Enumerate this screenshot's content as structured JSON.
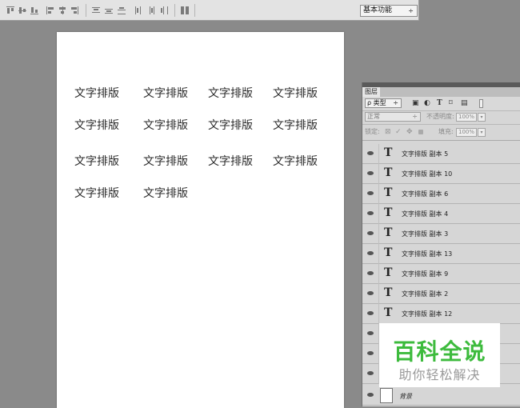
{
  "workspace": {
    "label": "基本功能",
    "arrow": "÷"
  },
  "canvas": {
    "texts": [
      "文字排版",
      "文字排版",
      "文字排版",
      "文字排版",
      "文字排版",
      "文字排版",
      "文字排版",
      "文字排版",
      "文字排版",
      "文字排版",
      "文字排版",
      "文字排版",
      "文字排版",
      "文字排版"
    ]
  },
  "layers_panel": {
    "tab": "图层",
    "filter_label": "ρ 类型",
    "filter_arrow": "÷",
    "filter_icons": [
      "▣",
      "◐",
      "T",
      "⌑",
      "▤"
    ],
    "blend_mode": "正常",
    "opacity_label": "不透明度:",
    "opacity_value": "100%",
    "lock_label": "锁定:",
    "lock_icons": [
      "⊠",
      "✓",
      "✥",
      "🔒"
    ],
    "fill_label": "填充:",
    "fill_value": "100%",
    "layers": [
      {
        "icon": "T",
        "name": "文字排版 副本 5"
      },
      {
        "icon": "T",
        "name": "文字排版 副本 10"
      },
      {
        "icon": "T",
        "name": "文字排版 副本 6"
      },
      {
        "icon": "T",
        "name": "文字排版 副本 4"
      },
      {
        "icon": "T",
        "name": "文字排版 副本 3"
      },
      {
        "icon": "T",
        "name": "文字排版 副本 13"
      },
      {
        "icon": "T",
        "name": "文字排版 副本 9"
      },
      {
        "icon": "T",
        "name": "文字排版 副本 2"
      },
      {
        "icon": "T",
        "name": "文字排版 副本 12"
      }
    ],
    "background_layer": "背景"
  },
  "watermark": {
    "title": "百科全说",
    "subtitle": "助你轻松解决"
  }
}
